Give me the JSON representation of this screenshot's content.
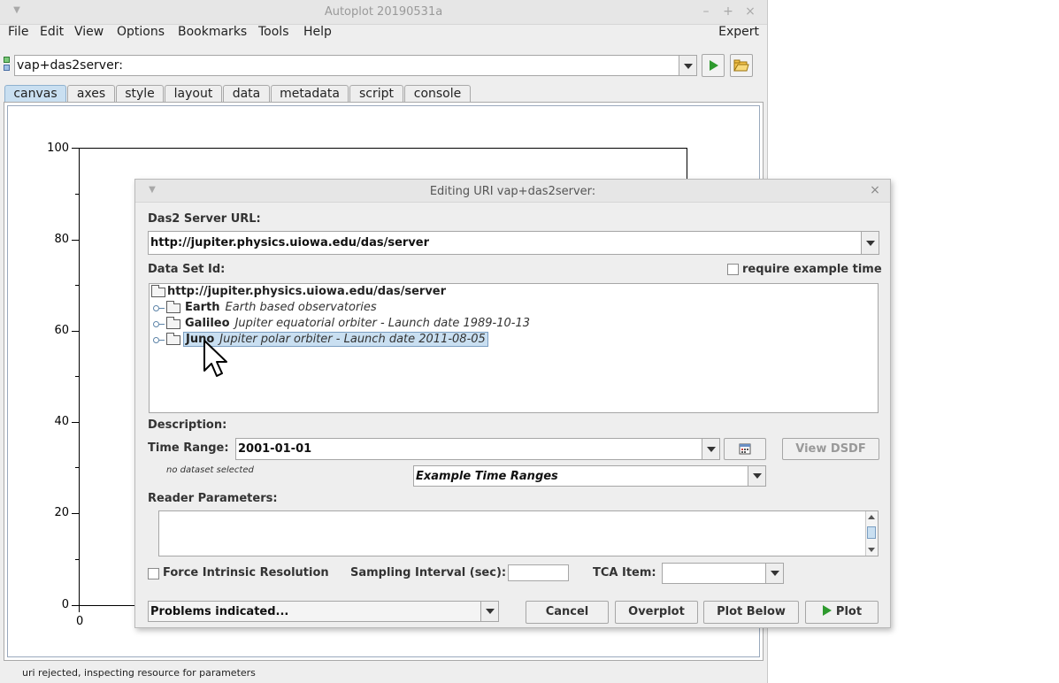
{
  "main_window": {
    "title": "Autoplot 20190531a",
    "menu": [
      "File",
      "Edit",
      "View",
      "Options",
      "Bookmarks",
      "Tools",
      "Help"
    ],
    "mode_label": "Expert",
    "uri": "vap+das2server:",
    "tabs": [
      "canvas",
      "axes",
      "style",
      "layout",
      "data",
      "metadata",
      "script",
      "console"
    ],
    "active_tab": "canvas",
    "y_ticks": [
      "100",
      "80",
      "60",
      "40",
      "20",
      "0"
    ],
    "x_tick": "0",
    "status_text": "uri rejected, inspecting resource for parameters"
  },
  "dialog": {
    "title": "Editing URI vap+das2server:",
    "server_url_label": "Das2 Server URL:",
    "server_url": "http://jupiter.physics.uiowa.edu/das/server",
    "dataset_id_label": "Data Set Id:",
    "require_example_time_label": "require example time",
    "tree": {
      "root": "http://jupiter.physics.uiowa.edu/das/server",
      "nodes": [
        {
          "name": "Earth",
          "desc": "Earth based observatories"
        },
        {
          "name": "Galileo",
          "desc": "Jupiter equatorial orbiter - Launch date 1989-10-13"
        },
        {
          "name": "Juno",
          "desc": "Jupiter polar orbiter - Launch date 2011-08-05"
        }
      ]
    },
    "description_label": "Description:",
    "time_range_label": "Time Range:",
    "time_range": "2001-01-01",
    "view_dsdf_label": "View DSDF",
    "no_dataset_text": "no dataset selected",
    "example_time_ranges_label": "Example Time Ranges",
    "reader_params_label": "Reader Parameters:",
    "force_intrinsic_label": "Force Intrinsic Resolution",
    "sampling_interval_label": "Sampling Interval (sec):",
    "tca_item_label": "TCA Item:",
    "problems_label": "Problems indicated...",
    "buttons": {
      "cancel": "Cancel",
      "overplot": "Overplot",
      "plot_below": "Plot Below",
      "plot": "Plot"
    }
  },
  "colors": {
    "tab_active": "#c9dff1",
    "selection": "#c9dff1",
    "play_green": "#2e9a2e",
    "window_bg": "#eeeeee"
  }
}
